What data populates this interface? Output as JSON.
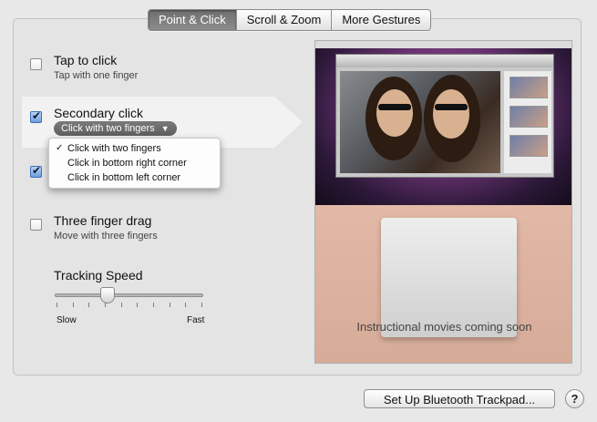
{
  "tabs": [
    {
      "label": "Point & Click",
      "active": true
    },
    {
      "label": "Scroll & Zoom",
      "active": false
    },
    {
      "label": "More Gestures",
      "active": false
    }
  ],
  "options": {
    "tap_to_click": {
      "title": "Tap to click",
      "subtitle": "Tap with one finger",
      "checked": false
    },
    "secondary_click": {
      "title": "Secondary click",
      "selected_value": "Click with two fingers",
      "checked": true
    },
    "look_up": {
      "checked": true
    },
    "three_finger_drag": {
      "title": "Three finger drag",
      "subtitle": "Move with three fingers",
      "checked": false
    }
  },
  "dropdown": {
    "items": [
      {
        "label": "Click with two fingers",
        "selected": true
      },
      {
        "label": "Click in bottom right corner",
        "selected": false
      },
      {
        "label": "Click in bottom left corner",
        "selected": false
      }
    ],
    "check_glyph": "✓"
  },
  "tracking": {
    "title": "Tracking Speed",
    "min_label": "Slow",
    "max_label": "Fast",
    "tick_count": 10,
    "level_fraction": 0.35
  },
  "preview": {
    "caption": "Instructional movies coming soon"
  },
  "footer": {
    "setup_button": "Set Up Bluetooth Trackpad...",
    "help": "?"
  },
  "colors": {
    "active_tab": "#7a7a7a",
    "checkbox_checked": "#6f9ede",
    "pill": "#6a6a6a"
  }
}
